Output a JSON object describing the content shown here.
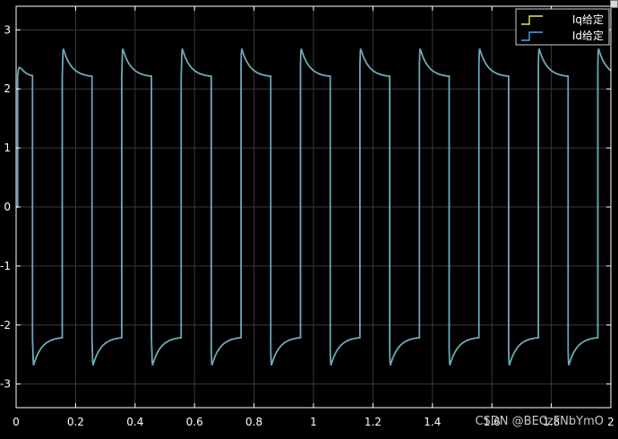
{
  "chart_data": {
    "type": "line",
    "title": "",
    "xlabel": "",
    "ylabel": "",
    "xlim": [
      0,
      2
    ],
    "ylim": [
      -3.4,
      3.4
    ],
    "xticks": [
      "0",
      "0.2",
      "0.4",
      "0.6",
      "0.8",
      "1",
      "1.2",
      "1.4",
      "1.6",
      "1.8",
      "2"
    ],
    "yticks": [
      "3",
      "2",
      "1",
      "0",
      "-1",
      "-2",
      "-3"
    ],
    "grid": true,
    "legend_position": "top-right",
    "background": "#000000",
    "axis_color": "#ffffff",
    "grid_color": "#3a3a3a",
    "series": [
      {
        "name": "Iq给定",
        "color": "#e8e86a",
        "square_wave": {
          "period": 0.2,
          "first_rise": 0.005,
          "high_start": 0.155,
          "high_end": 0.255,
          "high_level": 2.2,
          "low_level": -2.2,
          "overshoot_peak": 2.75,
          "decay_time": 0.028
        }
      },
      {
        "name": "Id给定",
        "color": "#4ea6ea",
        "square_wave": {
          "period": 0.2,
          "first_rise": 0.005,
          "high_start": 0.155,
          "high_end": 0.255,
          "high_level": 2.2,
          "low_level": -2.2,
          "overshoot_peak": 2.75,
          "decay_time": 0.028
        }
      }
    ]
  },
  "watermark": "CSDN @BECzFNbYmO"
}
